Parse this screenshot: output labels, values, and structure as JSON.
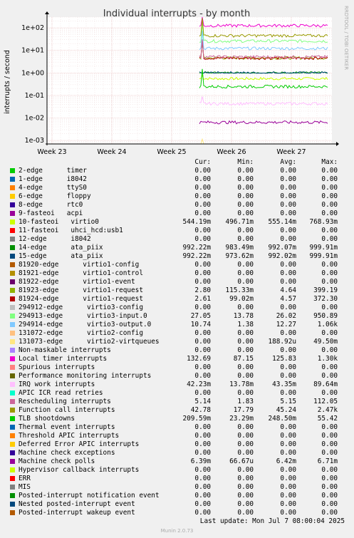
{
  "chart_data": {
    "type": "line",
    "title": "Individual interrupts - by month",
    "ylabel": "interrupts / second",
    "y_scale": "log",
    "ylim": [
      0.0007,
      300
    ],
    "y_ticks": [
      "1e+02",
      "1e+01",
      "1e+00",
      "1e-01",
      "1e-02",
      "1e-03"
    ],
    "x_ticks": [
      "Week 23",
      "Week 24",
      "Week 25",
      "Week 26",
      "Week 27"
    ],
    "watermark": "RRDTOOL / TOBI OETIKER",
    "grid": true,
    "columns": [
      "Cur:",
      "Min:",
      "Avg:",
      "Max:"
    ],
    "series": [
      {
        "name": "2-edge      timer",
        "color": "#00cc00",
        "cur": "0.00",
        "min": "0.00",
        "avg": "0.00",
        "max": "0.00"
      },
      {
        "name": "1-edge      i8042",
        "color": "#0066b3",
        "cur": "0.00",
        "min": "0.00",
        "avg": "0.00",
        "max": "0.00"
      },
      {
        "name": "4-edge      ttyS0",
        "color": "#ff8000",
        "cur": "0.00",
        "min": "0.00",
        "avg": "0.00",
        "max": "0.00"
      },
      {
        "name": "6-edge      floppy",
        "color": "#ffcc00",
        "cur": "0.00",
        "min": "0.00",
        "avg": "0.00",
        "max": "0.00"
      },
      {
        "name": "8-edge      rtc0",
        "color": "#330099",
        "cur": "0.00",
        "min": "0.00",
        "avg": "0.00",
        "max": "0.00"
      },
      {
        "name": "9-fasteoi   acpi",
        "color": "#990099",
        "cur": "0.00",
        "min": "0.00",
        "avg": "0.00",
        "max": "0.00"
      },
      {
        "name": "10-fasteoi   virtio0",
        "color": "#ccff00",
        "cur": "544.19m",
        "min": "496.71m",
        "avg": "555.14m",
        "max": "768.93m"
      },
      {
        "name": "11-fasteoi   uhci_hcd:usb1",
        "color": "#ff0000",
        "cur": "0.00",
        "min": "0.00",
        "avg": "0.00",
        "max": "0.00"
      },
      {
        "name": "12-edge      i8042",
        "color": "#808080",
        "cur": "0.00",
        "min": "0.00",
        "avg": "0.00",
        "max": "0.00"
      },
      {
        "name": "14-edge      ata_piix",
        "color": "#008f00",
        "cur": "992.22m",
        "min": "983.49m",
        "avg": "992.07m",
        "max": "999.91m"
      },
      {
        "name": "15-edge      ata_piix",
        "color": "#00487d",
        "cur": "992.22m",
        "min": "973.62m",
        "avg": "992.02m",
        "max": "999.91m"
      },
      {
        "name": "81920-edge      virtio1-config",
        "color": "#b35a00",
        "cur": "0.00",
        "min": "0.00",
        "avg": "0.00",
        "max": "0.00"
      },
      {
        "name": "81921-edge      virtio1-control",
        "color": "#b38f00",
        "cur": "0.00",
        "min": "0.00",
        "avg": "0.00",
        "max": "0.00"
      },
      {
        "name": "81922-edge      virtio1-event",
        "color": "#6b006b",
        "cur": "0.00",
        "min": "0.00",
        "avg": "0.00",
        "max": "0.00"
      },
      {
        "name": "81923-edge      virtio1-request",
        "color": "#8fb300",
        "cur": "2.80",
        "min": "115.33m",
        "avg": "4.64",
        "max": "399.19"
      },
      {
        "name": "81924-edge      virtio1-request",
        "color": "#b30000",
        "cur": "2.61",
        "min": "99.02m",
        "avg": "4.57",
        "max": "372.30"
      },
      {
        "name": "294912-edge      virtio3-config",
        "color": "#bebebe",
        "cur": "0.00",
        "min": "0.00",
        "avg": "0.00",
        "max": "0.00"
      },
      {
        "name": "294913-edge      virtio3-input.0",
        "color": "#80ff80",
        "cur": "27.05",
        "min": "13.78",
        "avg": "26.02",
        "max": "950.89"
      },
      {
        "name": "294914-edge      virtio3-output.0",
        "color": "#80c9ff",
        "cur": "10.74",
        "min": "1.38",
        "avg": "12.27",
        "max": "1.06k"
      },
      {
        "name": "131072-edge      virtio2-config",
        "color": "#ffc080",
        "cur": "0.00",
        "min": "0.00",
        "avg": "0.00",
        "max": "0.00"
      },
      {
        "name": "131073-edge      virtio2-virtqueues",
        "color": "#ffe680",
        "cur": "0.00",
        "min": "0.00",
        "avg": "188.92u",
        "max": "49.50m"
      },
      {
        "name": "Non-maskable interrupts",
        "color": "#aa80ff",
        "cur": "0.00",
        "min": "0.00",
        "avg": "0.00",
        "max": "0.00"
      },
      {
        "name": "Local timer interrupts",
        "color": "#ee00cc",
        "cur": "132.69",
        "min": "87.15",
        "avg": "125.83",
        "max": "1.30k"
      },
      {
        "name": "Spurious interrupts",
        "color": "#ff8080",
        "cur": "0.00",
        "min": "0.00",
        "avg": "0.00",
        "max": "0.00"
      },
      {
        "name": "Performance monitoring interrupts",
        "color": "#666600",
        "cur": "0.00",
        "min": "0.00",
        "avg": "0.00",
        "max": "0.00"
      },
      {
        "name": "IRQ work interrupts",
        "color": "#ffbfff",
        "cur": "42.23m",
        "min": "13.78m",
        "avg": "43.35m",
        "max": "89.64m"
      },
      {
        "name": "APIC ICR read retries",
        "color": "#00ffcc",
        "cur": "0.00",
        "min": "0.00",
        "avg": "0.00",
        "max": "0.00"
      },
      {
        "name": "Rescheduling interrupts",
        "color": "#cc6699",
        "cur": "5.14",
        "min": "1.83",
        "avg": "5.15",
        "max": "112.05"
      },
      {
        "name": "Function call interrupts",
        "color": "#999900",
        "cur": "42.78",
        "min": "17.79",
        "avg": "45.24",
        "max": "2.47k"
      },
      {
        "name": "TLB shootdowns",
        "color": "#00cc00",
        "cur": "209.59m",
        "min": "23.29m",
        "avg": "248.50m",
        "max": "55.42"
      },
      {
        "name": "Thermal event interrupts",
        "color": "#0066b3",
        "cur": "0.00",
        "min": "0.00",
        "avg": "0.00",
        "max": "0.00"
      },
      {
        "name": "Threshold APIC interrupts",
        "color": "#ff8000",
        "cur": "0.00",
        "min": "0.00",
        "avg": "0.00",
        "max": "0.00"
      },
      {
        "name": "Deferred Error APIC interrupts",
        "color": "#ffcc00",
        "cur": "0.00",
        "min": "0.00",
        "avg": "0.00",
        "max": "0.00"
      },
      {
        "name": "Machine check exceptions",
        "color": "#330099",
        "cur": "0.00",
        "min": "0.00",
        "avg": "0.00",
        "max": "0.00"
      },
      {
        "name": "Machine check polls",
        "color": "#990099",
        "cur": "6.39m",
        "min": "66.67u",
        "avg": "6.42m",
        "max": "6.71m"
      },
      {
        "name": "Hypervisor callback interrupts",
        "color": "#ccff00",
        "cur": "0.00",
        "min": "0.00",
        "avg": "0.00",
        "max": "0.00"
      },
      {
        "name": "ERR",
        "color": "#ff0000",
        "cur": "0.00",
        "min": "0.00",
        "avg": "0.00",
        "max": "0.00"
      },
      {
        "name": "MIS",
        "color": "#808080",
        "cur": "0.00",
        "min": "0.00",
        "avg": "0.00",
        "max": "0.00"
      },
      {
        "name": "Posted-interrupt notification event",
        "color": "#008f00",
        "cur": "0.00",
        "min": "0.00",
        "avg": "0.00",
        "max": "0.00"
      },
      {
        "name": "Nested posted-interrupt event",
        "color": "#00487d",
        "cur": "0.00",
        "min": "0.00",
        "avg": "0.00",
        "max": "0.00"
      },
      {
        "name": "Posted-interrupt wakeup event",
        "color": "#b35a00",
        "cur": "0.00",
        "min": "0.00",
        "avg": "0.00",
        "max": "0.00"
      }
    ]
  },
  "footer": {
    "last_update": "Last update: Mon Jul  7 08:00:04 2025",
    "munin_version": "Munin 2.0.73"
  }
}
